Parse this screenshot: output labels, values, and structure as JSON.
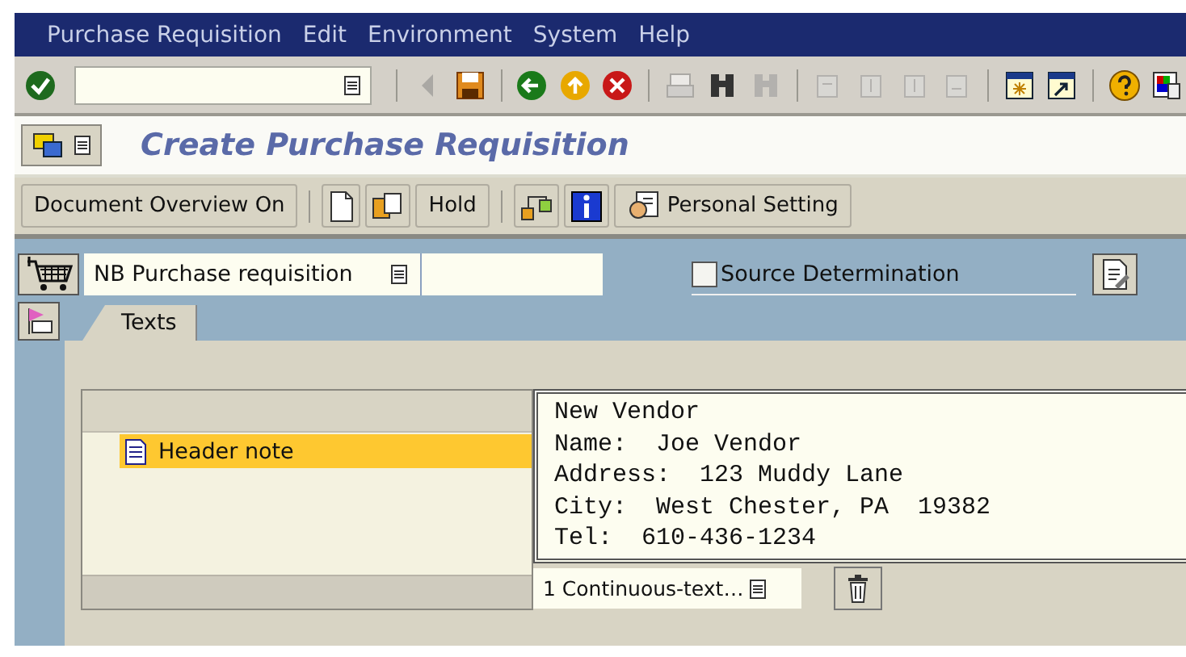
{
  "menu_bar": {
    "items": [
      "Purchase Requisition",
      "Edit",
      "Environment",
      "System",
      "Help"
    ]
  },
  "system_toolbar": {
    "icons": [
      {
        "disabled": true
      },
      {
        "disabled": false
      },
      {
        "disabled": false
      },
      {
        "disabled": false
      },
      {
        "disabled": false
      },
      {
        "disabled": true
      },
      {
        "disabled": false
      },
      {
        "disabled": true
      },
      {
        "disabled": true
      },
      {
        "disabled": true
      },
      {
        "disabled": true
      },
      {
        "disabled": true
      },
      {
        "disabled": false
      },
      {
        "disabled": false
      },
      {
        "disabled": false
      },
      {
        "disabled": false
      }
    ]
  },
  "title": "Create Purchase Requisition",
  "app_toolbar": {
    "buttons": [
      {
        "kind": "text",
        "label": "Document Overview On"
      },
      {
        "kind": "icon"
      },
      {
        "kind": "icon"
      },
      {
        "kind": "text",
        "label": "Hold"
      },
      {
        "kind": "icon"
      },
      {
        "kind": "icon"
      },
      {
        "kind": "icon_text",
        "label": "Personal Setting"
      }
    ]
  },
  "header": {
    "document_type": {
      "value": "NB Purchase requisition"
    },
    "source_determination": {
      "label": "Source Determination",
      "checked": false
    }
  },
  "tabs": [
    {
      "label": "Texts",
      "selected": true
    }
  ],
  "text_tree": {
    "items": [
      {
        "label": "Header note",
        "selected": true
      }
    ]
  },
  "editor": {
    "lines": [
      "New Vendor",
      "Name:  Joe Vendor",
      "Address:  123 Muddy Lane",
      "City:  West Chester, PA  19382",
      "Tel:  610-436-1234"
    ]
  },
  "format_dropdown": {
    "value": "1 Continuous-text…"
  }
}
